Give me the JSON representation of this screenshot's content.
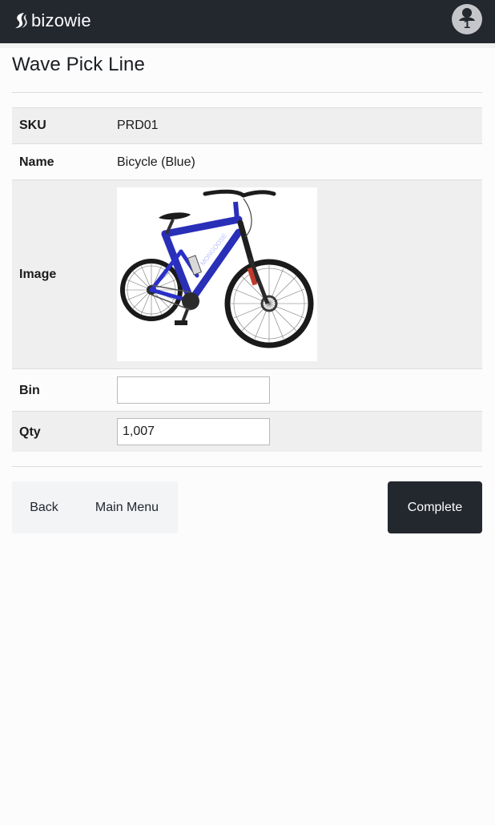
{
  "header": {
    "brand": "bizowie",
    "logo_icon": "bizowie-swoosh-icon",
    "user_icon": "user-icon",
    "user_count": "1",
    "bar_color": "#23272e"
  },
  "page": {
    "title": "Wave Pick Line"
  },
  "details": {
    "sku_label": "SKU",
    "sku_value": "PRD01",
    "name_label": "Name",
    "name_value": "Bicycle (Blue)",
    "image_label": "Image",
    "image_alt": "Bicycle (Blue)",
    "bin_label": "Bin",
    "bin_value": "",
    "qty_label": "Qty",
    "qty_value": "1,007"
  },
  "actions": {
    "back_label": "Back",
    "main_menu_label": "Main Menu",
    "complete_label": "Complete"
  }
}
